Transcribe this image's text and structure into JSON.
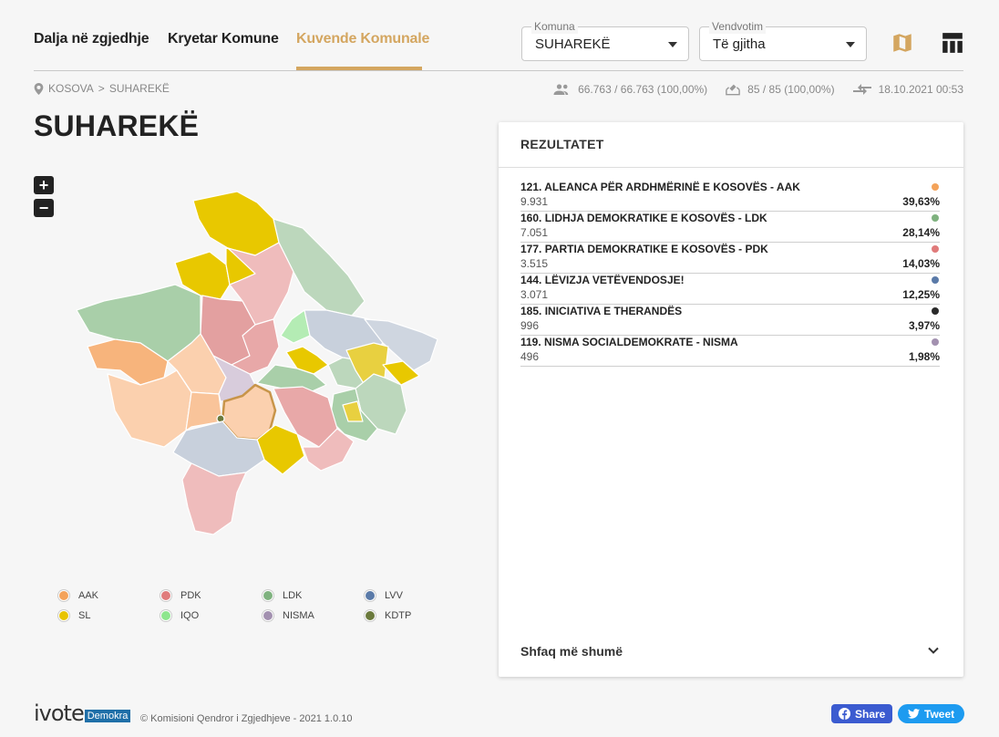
{
  "nav": {
    "tabs": [
      {
        "label": "Dalja në zgjedhje"
      },
      {
        "label": "Kryetar Komune"
      },
      {
        "label": "Kuvende Komunale"
      }
    ],
    "active_tab": 2,
    "komuna": {
      "legend": "Komuna",
      "value": "SUHAREKË"
    },
    "vendvotim": {
      "legend": "Vendvotim",
      "value": "Të gjitha"
    },
    "accent_color": "#d4a660",
    "icons": [
      "map-icon",
      "table-icon"
    ]
  },
  "breadcrumb": {
    "root": "KOSOVA",
    "separator": ">",
    "current": "SUHAREKË"
  },
  "stats": {
    "voters": "66.763 / 66.763 (100,00%)",
    "stations": "85 / 85 (100,00%)",
    "updated": "18.10.2021 00:53"
  },
  "page_title": "SUHAREKË",
  "zoom": {
    "in": "+",
    "out": "−"
  },
  "legend": [
    {
      "label": "AAK",
      "color": "#f4a35a"
    },
    {
      "label": "PDK",
      "color": "#e07b7b"
    },
    {
      "label": "LDK",
      "color": "#7fb27f"
    },
    {
      "label": "LVV",
      "color": "#5a7aa8"
    },
    {
      "label": "SL",
      "color": "#e8c400"
    },
    {
      "label": "IQO",
      "color": "#8ee68e"
    },
    {
      "label": "NISMA",
      "color": "#a391b0"
    },
    {
      "label": "KDTP",
      "color": "#6b7a3c"
    }
  ],
  "results": {
    "title": "REZULTATET",
    "rows": [
      {
        "name": "121. ALEANCA PËR ARDHMËRINË E KOSOVËS - AAK",
        "votes": "9.931",
        "pct": "39,63%",
        "color": "#f4a35a"
      },
      {
        "name": "160. LIDHJA DEMOKRATIKE E KOSOVËS - LDK",
        "votes": "7.051",
        "pct": "28,14%",
        "color": "#7fb27f"
      },
      {
        "name": "177. PARTIA DEMOKRATIKE E KOSOVËS - PDK",
        "votes": "3.515",
        "pct": "14,03%",
        "color": "#e07b7b"
      },
      {
        "name": "144. LËVIZJA VETËVENDOSJE!",
        "votes": "3.071",
        "pct": "12,25%",
        "color": "#5a7aa8"
      },
      {
        "name": "185. INICIATIVA E THERANDËS",
        "votes": "996",
        "pct": "3,97%",
        "color": "#2a2a2a"
      },
      {
        "name": "119. NISMA SOCIALDEMOKRATE - NISMA",
        "votes": "496",
        "pct": "1,98%",
        "color": "#a391b0"
      }
    ],
    "show_more": "Shfaq më shumë"
  },
  "footer": {
    "logo_text": "ivote",
    "logo_badge": "Demokra",
    "copyright": "© Komisioni Qendror i Zgjedhjeve - 2021 1.0.10",
    "share": "Share",
    "tweet": "Tweet"
  }
}
